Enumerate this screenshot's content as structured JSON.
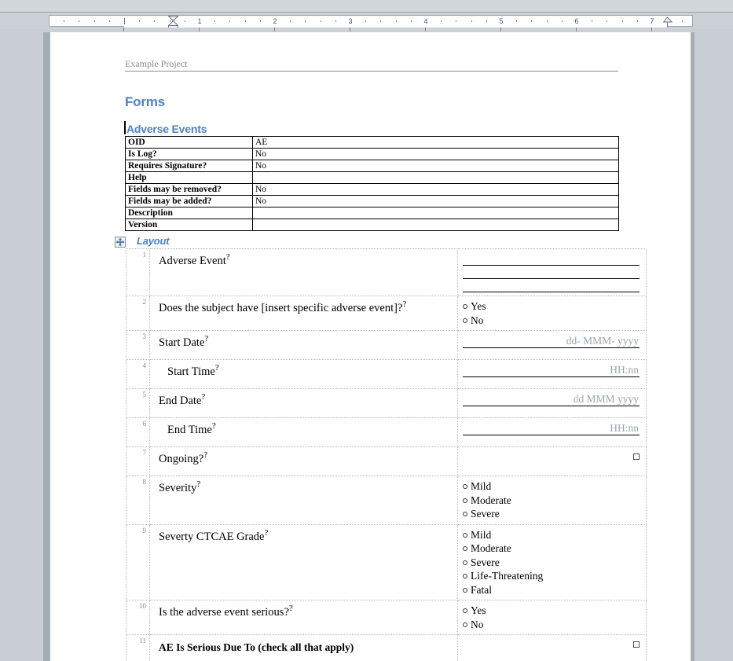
{
  "window": {
    "app_kind": "word-processor-document-view"
  },
  "ruler": {
    "unit_labels": [
      "1",
      "2",
      "3",
      "4",
      "5",
      "6",
      "7"
    ],
    "left_indent_marker": "hourglass-indent-marker",
    "right_indent_marker": "right-indent-marker"
  },
  "document": {
    "header_text": "Example Project",
    "title": "Forms",
    "section_title": "Adverse Events",
    "layout_heading": "Layout",
    "move_handle_icon": "move-four-arrows-icon"
  },
  "properties_table": {
    "rows": [
      {
        "key": "OID",
        "value": "AE"
      },
      {
        "key": "Is Log?",
        "value": "No"
      },
      {
        "key": "Requires Signature?",
        "value": "No"
      },
      {
        "key": "Help",
        "value": ""
      },
      {
        "key": "Fields may be removed?",
        "value": "No"
      },
      {
        "key": "Fields may be added?",
        "value": "No"
      },
      {
        "key": "Description",
        "value": ""
      },
      {
        "key": "Version",
        "value": ""
      }
    ]
  },
  "layout_table": {
    "rows": [
      {
        "number": "1",
        "question": "Adverse Event",
        "has_help": true,
        "control": "text-lines",
        "lines": 3
      },
      {
        "number": "2",
        "question": "Does the subject have [insert specific adverse event]?",
        "has_help": true,
        "control": "radio",
        "options": [
          "Yes",
          "No"
        ]
      },
      {
        "number": "3",
        "question": "Start Date",
        "has_help": true,
        "control": "format-line",
        "format": "dd- MMM- yyyy"
      },
      {
        "number": "4",
        "question": "Start Time",
        "has_help": true,
        "indented": true,
        "control": "format-line",
        "format": "HH:nn"
      },
      {
        "number": "5",
        "question": "End Date",
        "has_help": true,
        "control": "format-line",
        "format": "dd MMM yyyy"
      },
      {
        "number": "6",
        "question": "End Time",
        "has_help": true,
        "indented": true,
        "control": "format-line",
        "format": "HH:nn"
      },
      {
        "number": "7",
        "question": "Ongoing?",
        "has_help": true,
        "control": "checkbox"
      },
      {
        "number": "8",
        "question": "Severity",
        "has_help": true,
        "control": "radio",
        "options": [
          "Mild",
          "Moderate",
          "Severe"
        ]
      },
      {
        "number": "9",
        "question": "Severty CTCAE Grade",
        "has_help": true,
        "control": "radio",
        "options": [
          "Mild",
          "Moderate",
          "Severe",
          "Life-Threatening",
          "Fatal"
        ]
      },
      {
        "number": "10",
        "question": "Is the adverse event serious?",
        "has_help": true,
        "control": "radio",
        "options": [
          "Yes",
          "No"
        ]
      },
      {
        "number": "11",
        "question": "AE Is Serious Due To (check all that apply)",
        "has_help": false,
        "bold": true,
        "control": "checkbox"
      }
    ]
  },
  "colors": {
    "heading_blue": "#4F81BD",
    "header_gray": "#8A8A8A",
    "placeholder_gray": "#9AA5B1",
    "canvas_gray": "#C9CED4",
    "gridline": "#B8B8B8"
  }
}
